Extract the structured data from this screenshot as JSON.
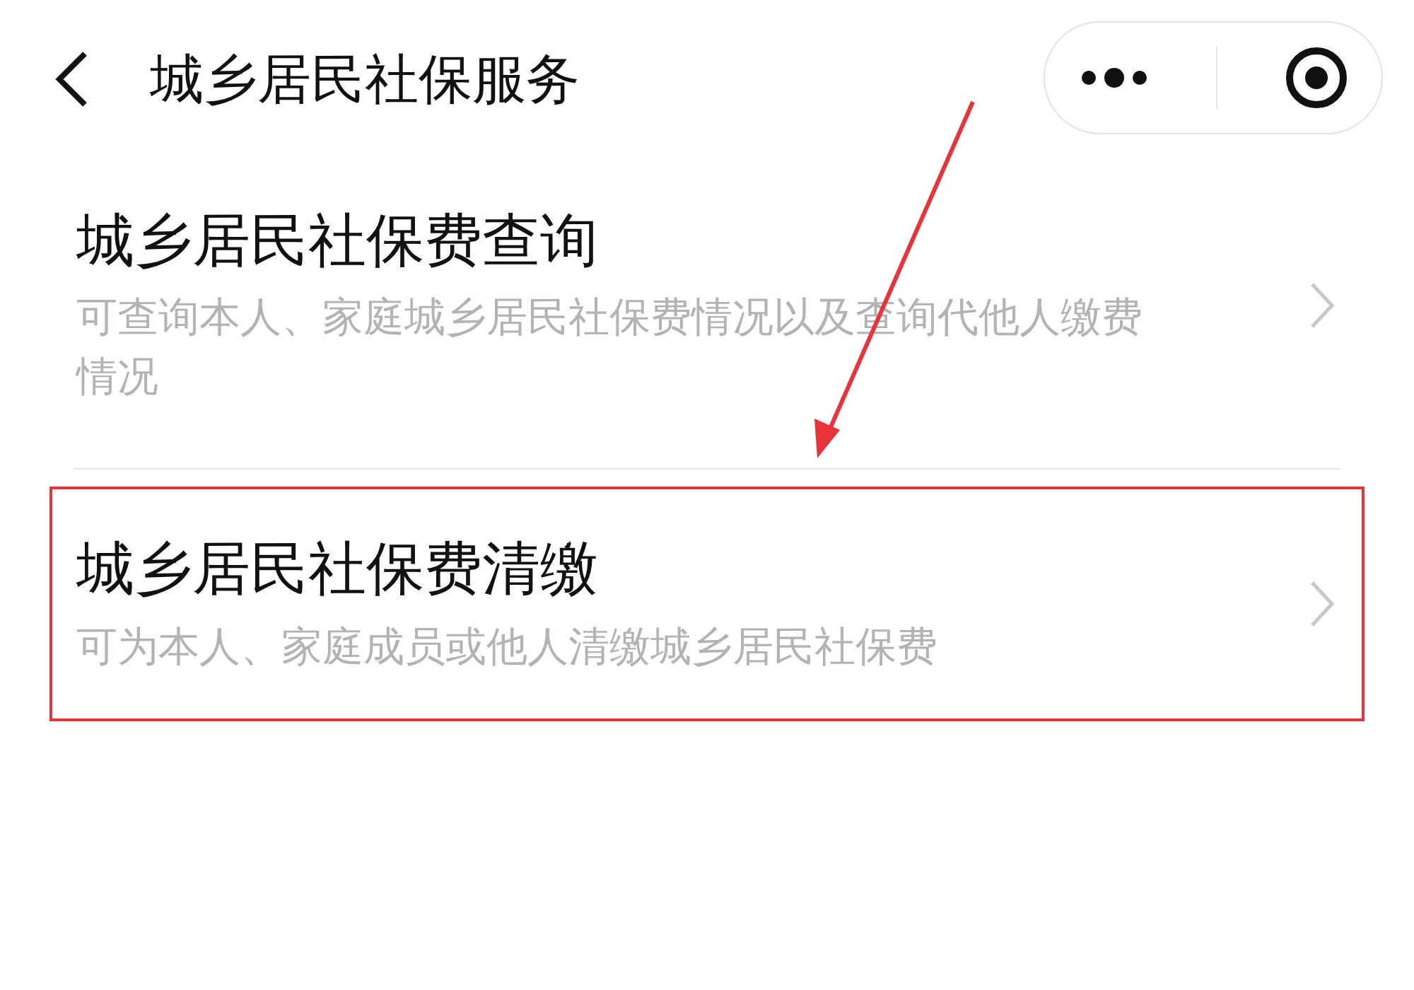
{
  "header": {
    "title": "城乡居民社保服务"
  },
  "items": [
    {
      "title": "城乡居民社保费查询",
      "description": "可查询本人、家庭城乡居民社保费情况以及查询代他人缴费情况",
      "highlighted": false
    },
    {
      "title": "城乡居民社保费清缴",
      "description": "可为本人、家庭成员或他人清缴城乡居民社保费",
      "highlighted": true
    }
  ]
}
